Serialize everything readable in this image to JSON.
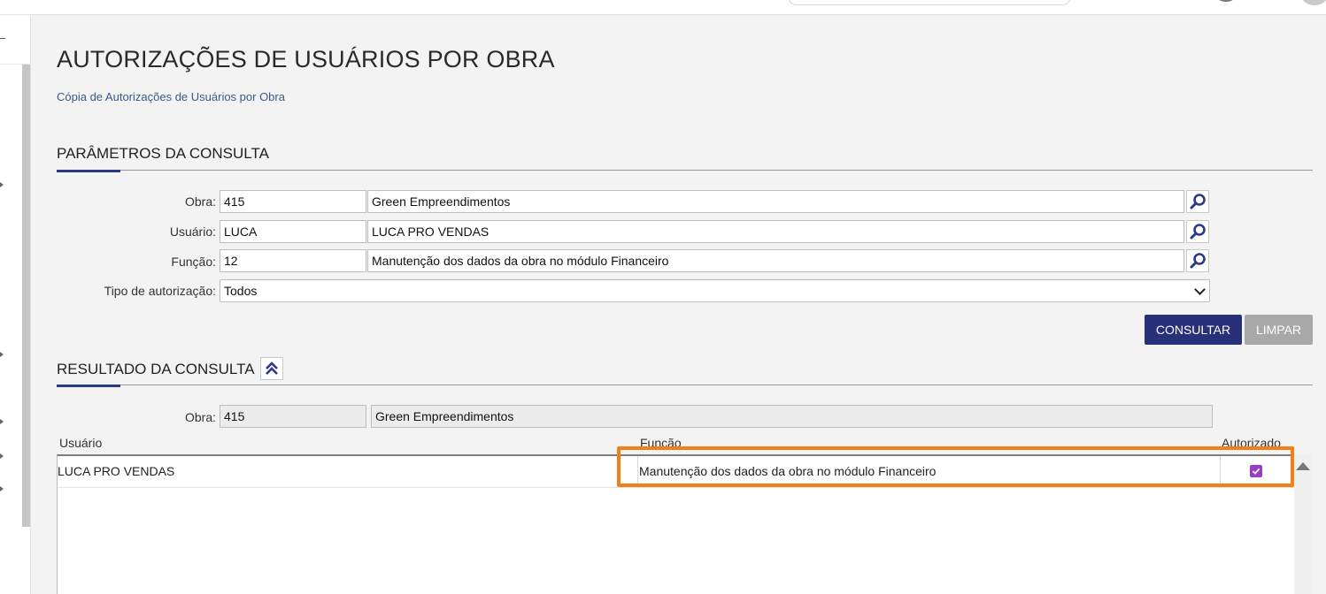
{
  "page": {
    "title": "AUTORIZAÇÕES DE USUÁRIOS POR OBRA",
    "copy_link": "Cópia de Autorizações de Usuários por Obra"
  },
  "params": {
    "section_title": "PARÂMETROS DA CONSULTA",
    "obra": {
      "label": "Obra:",
      "code": "415",
      "name": "Green Empreendimentos"
    },
    "usuario": {
      "label": "Usuário:",
      "code": "LUCA",
      "name": "LUCA PRO VENDAS"
    },
    "funcao": {
      "label": "Função:",
      "code": "12",
      "name": "Manutenção dos dados da obra no módulo Financeiro"
    },
    "tipo": {
      "label": "Tipo de autorização:",
      "value": "Todos"
    },
    "consultar_label": "CONSULTAR",
    "limpar_label": "LIMPAR"
  },
  "results": {
    "section_title": "RESULTADO DA CONSULTA",
    "obra": {
      "label": "Obra:",
      "code": "415",
      "name": "Green Empreendimentos"
    },
    "columns": [
      "Usuário",
      "Função",
      "Autorizado"
    ],
    "rows": [
      {
        "usuario": "LUCA PRO VENDAS",
        "funcao": "Manutenção dos dados da obra no módulo Financeiro",
        "autorizado": true
      }
    ]
  },
  "colors": {
    "primary_button": "#28307a",
    "disabled_button": "#a8a8a8",
    "highlight": "#f47f16",
    "checkbox": "#9b3cc4"
  }
}
